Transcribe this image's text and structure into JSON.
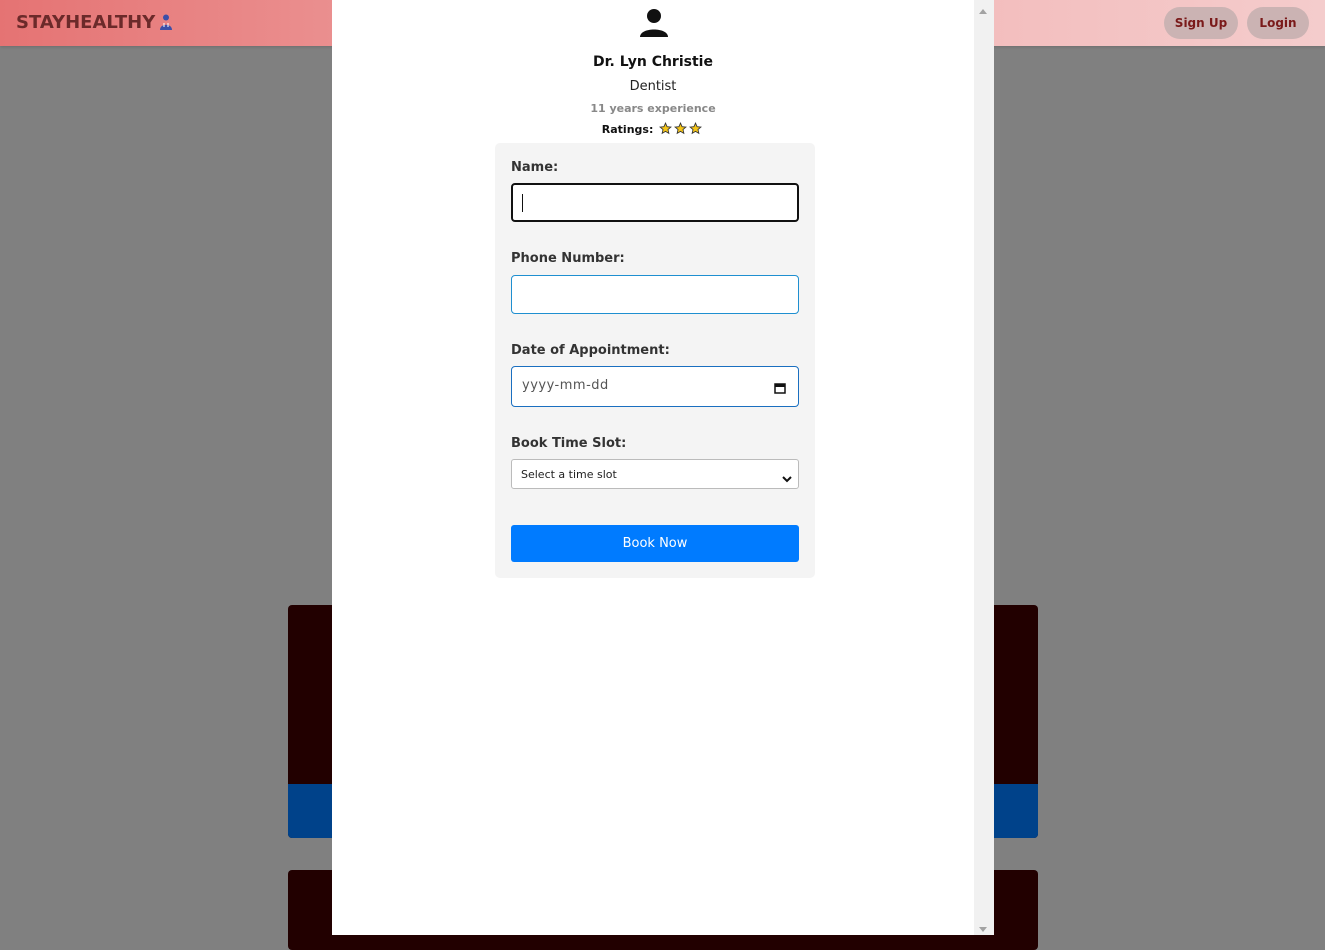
{
  "navbar": {
    "brand": "STAYHEALTHY",
    "brand_icon": "doctor-icon",
    "signup_label": "Sign Up",
    "login_label": "Login"
  },
  "modal": {
    "avatar_icon": "user-icon",
    "doctor_name": "Dr. Lyn Christie",
    "speciality": "Dentist",
    "experience": "11 years experience",
    "ratings_label": "Ratings:",
    "rating_stars": 3,
    "rating_icon": "star-icon"
  },
  "form": {
    "name_label": "Name:",
    "name_value": "",
    "phone_label": "Phone Number:",
    "phone_value": "",
    "date_label": "Date of Appointment:",
    "date_placeholder": "yyyy-mm-dd",
    "slot_label": "Book Time Slot:",
    "slot_selected": "Select a time slot",
    "submit_label": "Book Now"
  },
  "colors": {
    "accent": "#007bff",
    "nav_start": "#e57373",
    "nav_end": "#f4cccc"
  }
}
